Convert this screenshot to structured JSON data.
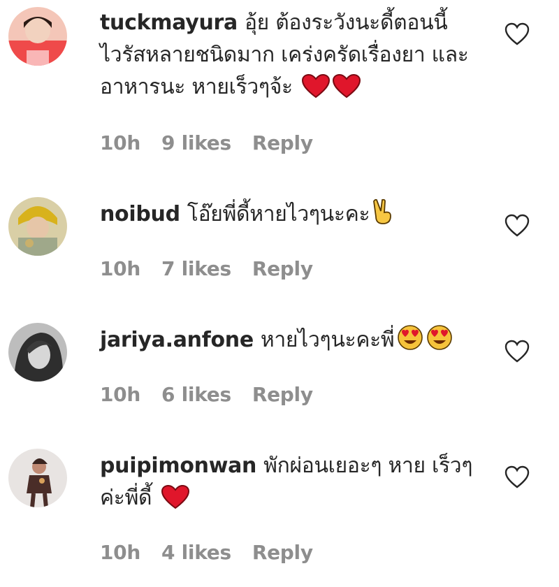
{
  "comments": [
    {
      "username": "tuckmayura",
      "text": "อุ้ย ต้องระวังนะดี้ตอนนี้ ไวรัสหลายชนิดมาก เคร่งครัดเรื่องยา และอาหารนะ หายเร็วๆจ้ะ",
      "emojis": [
        "red-heart",
        "red-heart"
      ],
      "time": "10h",
      "likes": "9 likes",
      "reply": "Reply"
    },
    {
      "username": "noibud",
      "text": "โอ๊ยพี่ดี้หายไวๆนะคะ",
      "emojis": [
        "victory-hand"
      ],
      "time": "10h",
      "likes": "7 likes",
      "reply": "Reply"
    },
    {
      "username": "jariya.anfone",
      "text": "หายไวๆนะคะพี่",
      "emojis": [
        "heart-eyes-face",
        "heart-eyes-face"
      ],
      "time": "10h",
      "likes": "6 likes",
      "reply": "Reply"
    },
    {
      "username": "puipimonwan",
      "text": "พักผ่อนเยอะๆ หาย เร็วๆค่ะพี่ดี้",
      "emojis": [
        "red-heart"
      ],
      "time": "10h",
      "likes": "4 likes",
      "reply": "Reply"
    }
  ],
  "colors": {
    "text": "#262626",
    "meta": "#8e8e8e",
    "heart_emoji": "#e0162b"
  }
}
